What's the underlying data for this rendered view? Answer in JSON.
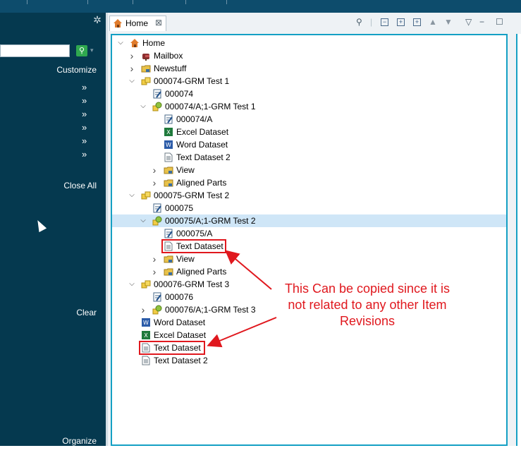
{
  "left_panel": {
    "customize": "Customize",
    "close_all": "Close All",
    "clear": "Clear",
    "organize": "Organize",
    "chevron": "»",
    "chevron_count": 6,
    "search_placeholder": ""
  },
  "view": {
    "tab_title": "Home",
    "tab_close": "⊠"
  },
  "tree": {
    "rows": [
      {
        "label": "Home",
        "depth": 0,
        "toggle": "open",
        "icon": "home-icon"
      },
      {
        "label": "Mailbox",
        "depth": 1,
        "toggle": "closed",
        "icon": "mailbox-icon"
      },
      {
        "label": "Newstuff",
        "depth": 1,
        "toggle": "closed",
        "icon": "folder-icon"
      },
      {
        "label": "000074-GRM Test 1",
        "depth": 1,
        "toggle": "open",
        "icon": "item-icon"
      },
      {
        "label": "000074",
        "depth": 2,
        "toggle": "none",
        "icon": "form-icon"
      },
      {
        "label": "000074/A;1-GRM Test 1",
        "depth": 2,
        "toggle": "open",
        "icon": "revision-icon"
      },
      {
        "label": "000074/A",
        "depth": 3,
        "toggle": "none",
        "icon": "form-icon"
      },
      {
        "label": "Excel Dataset",
        "depth": 3,
        "toggle": "none",
        "icon": "excel-icon"
      },
      {
        "label": "Word Dataset",
        "depth": 3,
        "toggle": "none",
        "icon": "word-icon"
      },
      {
        "label": "Text Dataset 2",
        "depth": 3,
        "toggle": "none",
        "icon": "text-doc-icon"
      },
      {
        "label": "View",
        "depth": 3,
        "toggle": "closed",
        "icon": "folder-icon"
      },
      {
        "label": "Aligned Parts",
        "depth": 3,
        "toggle": "closed",
        "icon": "folder-icon"
      },
      {
        "label": "000075-GRM Test 2",
        "depth": 1,
        "toggle": "open",
        "icon": "item-icon"
      },
      {
        "label": "000075",
        "depth": 2,
        "toggle": "none",
        "icon": "form-icon"
      },
      {
        "label": "000075/A;1-GRM Test 2",
        "depth": 2,
        "toggle": "open",
        "icon": "revision-icon",
        "selected": true
      },
      {
        "label": "000075/A",
        "depth": 3,
        "toggle": "none",
        "icon": "form-icon"
      },
      {
        "label": "Text Dataset",
        "depth": 3,
        "toggle": "none",
        "icon": "text-doc-icon",
        "highlight": true
      },
      {
        "label": "View",
        "depth": 3,
        "toggle": "closed",
        "icon": "folder-icon"
      },
      {
        "label": "Aligned Parts",
        "depth": 3,
        "toggle": "closed",
        "icon": "folder-icon"
      },
      {
        "label": "000076-GRM Test 3",
        "depth": 1,
        "toggle": "open",
        "icon": "item-icon"
      },
      {
        "label": "000076",
        "depth": 2,
        "toggle": "none",
        "icon": "form-icon"
      },
      {
        "label": "000076/A;1-GRM Test 3",
        "depth": 2,
        "toggle": "closed",
        "icon": "revision-icon"
      },
      {
        "label": "Word Dataset",
        "depth": 1,
        "toggle": "none",
        "icon": "word-icon"
      },
      {
        "label": "Excel Dataset",
        "depth": 1,
        "toggle": "none",
        "icon": "excel-icon"
      },
      {
        "label": "Text Dataset",
        "depth": 1,
        "toggle": "none",
        "icon": "text-doc-icon",
        "highlight": true
      },
      {
        "label": "Text Dataset 2",
        "depth": 1,
        "toggle": "none",
        "icon": "text-doc-icon"
      }
    ]
  },
  "annotation": {
    "lines": [
      "This Can be copied since it is",
      "not related to any other Item",
      "Revisions"
    ],
    "color": "#e0181e"
  },
  "colors": {
    "left_panel_bg": "#05394f",
    "accent_border": "#14a0c4",
    "selection": "#cfe6f7"
  }
}
